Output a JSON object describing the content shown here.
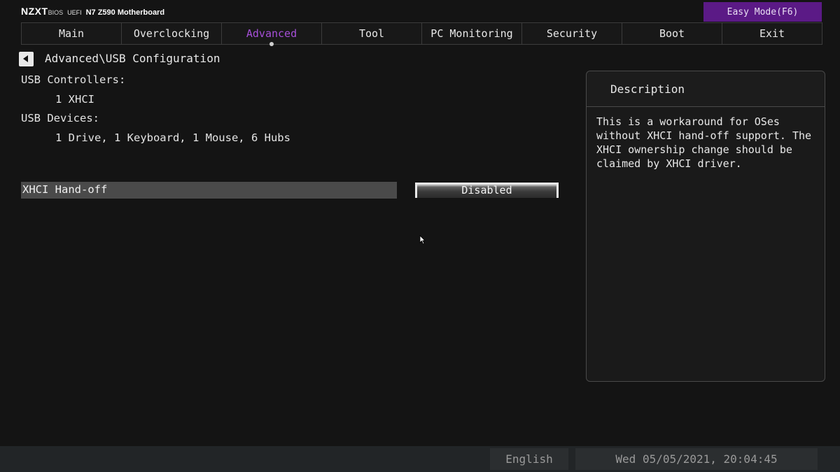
{
  "header": {
    "logo": "NZXT",
    "bios": "BIOS",
    "uefi": "UEFI",
    "model": "N7 Z590 Motherboard",
    "easy_mode": "Easy Mode(F6)"
  },
  "tabs": [
    {
      "label": "Main",
      "active": false
    },
    {
      "label": "Overclocking",
      "active": false
    },
    {
      "label": "Advanced",
      "active": true
    },
    {
      "label": "Tool",
      "active": false
    },
    {
      "label": "PC Monitoring",
      "active": false
    },
    {
      "label": "Security",
      "active": false
    },
    {
      "label": "Boot",
      "active": false
    },
    {
      "label": "Exit",
      "active": false
    }
  ],
  "breadcrumb": "Advanced\\USB Configuration",
  "usb": {
    "controllers_label": "USB Controllers:",
    "controllers_value": "1 XHCI",
    "devices_label": "USB Devices:",
    "devices_value": "1 Drive, 1 Keyboard, 1 Mouse, 6 Hubs"
  },
  "setting": {
    "label": "XHCI Hand-off",
    "value": "Disabled"
  },
  "description": {
    "title": "Description",
    "text": "This is a workaround for OSes without XHCI hand-off support. The XHCI ownership change should be claimed by XHCI driver."
  },
  "footer": {
    "language": "English",
    "datetime": "Wed 05/05/2021, 20:04:45"
  },
  "colors": {
    "accent": "#a64fd8",
    "easy_mode_bg": "#5b1a86",
    "background": "#141414"
  },
  "icons": {
    "back": "back-arrow-icon",
    "cursor": "mouse-pointer-icon"
  }
}
